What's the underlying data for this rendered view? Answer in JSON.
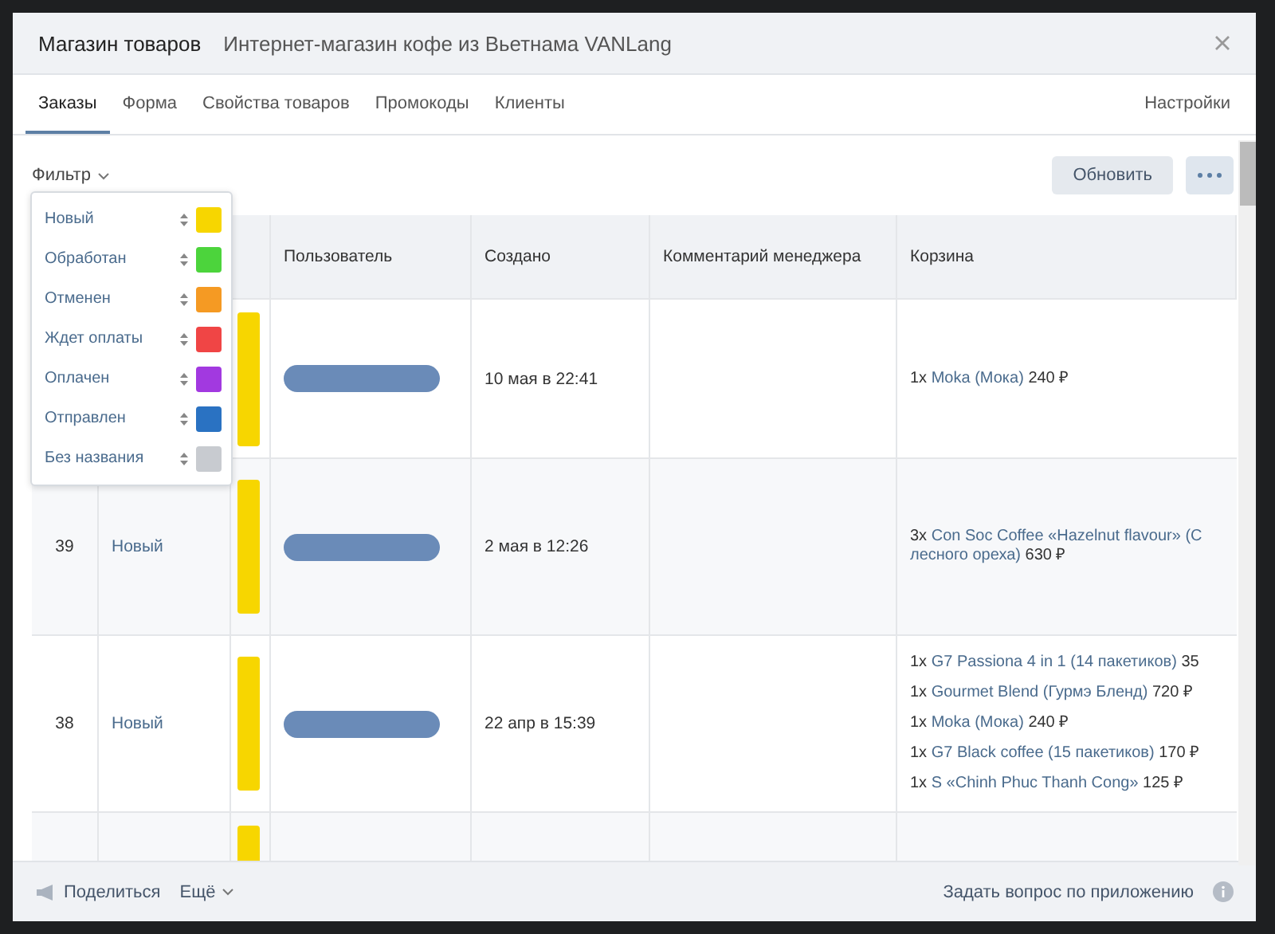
{
  "window": {
    "title": "Магазин товаров",
    "subtitle": "Интернет-магазин кофе из Вьетнама VANLang"
  },
  "tabs": [
    {
      "label": "Заказы",
      "selected": true
    },
    {
      "label": "Форма",
      "selected": false
    },
    {
      "label": "Свойства товаров",
      "selected": false
    },
    {
      "label": "Промокоды",
      "selected": false
    },
    {
      "label": "Клиенты",
      "selected": false
    }
  ],
  "settings_link": "Настройки",
  "filter": {
    "label": "Фильтр",
    "statuses": [
      {
        "name": "Новый",
        "color": "#f7d600"
      },
      {
        "name": "Обработан",
        "color": "#4cd43c"
      },
      {
        "name": "Отменен",
        "color": "#f59a23"
      },
      {
        "name": "Ждет оплаты",
        "color": "#f04545"
      },
      {
        "name": "Оплачен",
        "color": "#a239e0"
      },
      {
        "name": "Отправлен",
        "color": "#2a72c2"
      },
      {
        "name": "Без названия",
        "color": "#c8cbd0"
      }
    ]
  },
  "refresh_button": "Обновить",
  "table": {
    "columns": [
      "Пользователь",
      "Создано",
      "Комментарий менеджера",
      "Корзина"
    ],
    "rows": [
      {
        "color": "#f7d600",
        "created": "10 мая в 22:41",
        "cart": [
          {
            "qty": "1x",
            "name": "Moka (Мока)",
            "price": "240 ₽"
          }
        ]
      },
      {
        "id": "39",
        "status": "Новый",
        "color": "#f7d600",
        "created": "2 мая в 12:26",
        "cart": [
          {
            "qty": "3x",
            "name": "Con Soc Coffee «Hazelnut flavour» (C",
            "name_cont": "лесного ореха)",
            "price": "630 ₽"
          }
        ]
      },
      {
        "id": "38",
        "status": "Новый",
        "color": "#f7d600",
        "created": "22 апр в 15:39",
        "cart": [
          {
            "qty": "1x",
            "name": "G7 Passiona 4 in 1 (14 пакетиков)",
            "price": "35"
          },
          {
            "qty": "1x",
            "name": "Gourmet Blend (Гурмэ Бленд)",
            "price": "720 ₽"
          },
          {
            "qty": "1x",
            "name": "Moka (Мока)",
            "price": "240 ₽"
          },
          {
            "qty": "1x",
            "name": "G7 Black coffee (15 пакетиков)",
            "price": "170 ₽"
          },
          {
            "qty": "1x",
            "name": "S «Chinh Phuc Thanh Cong»",
            "price": "125 ₽"
          }
        ]
      },
      {
        "color": "#f7d600"
      }
    ]
  },
  "footer": {
    "share": "Поделиться",
    "more": "Ещё",
    "ask": "Задать вопрос по приложению"
  }
}
